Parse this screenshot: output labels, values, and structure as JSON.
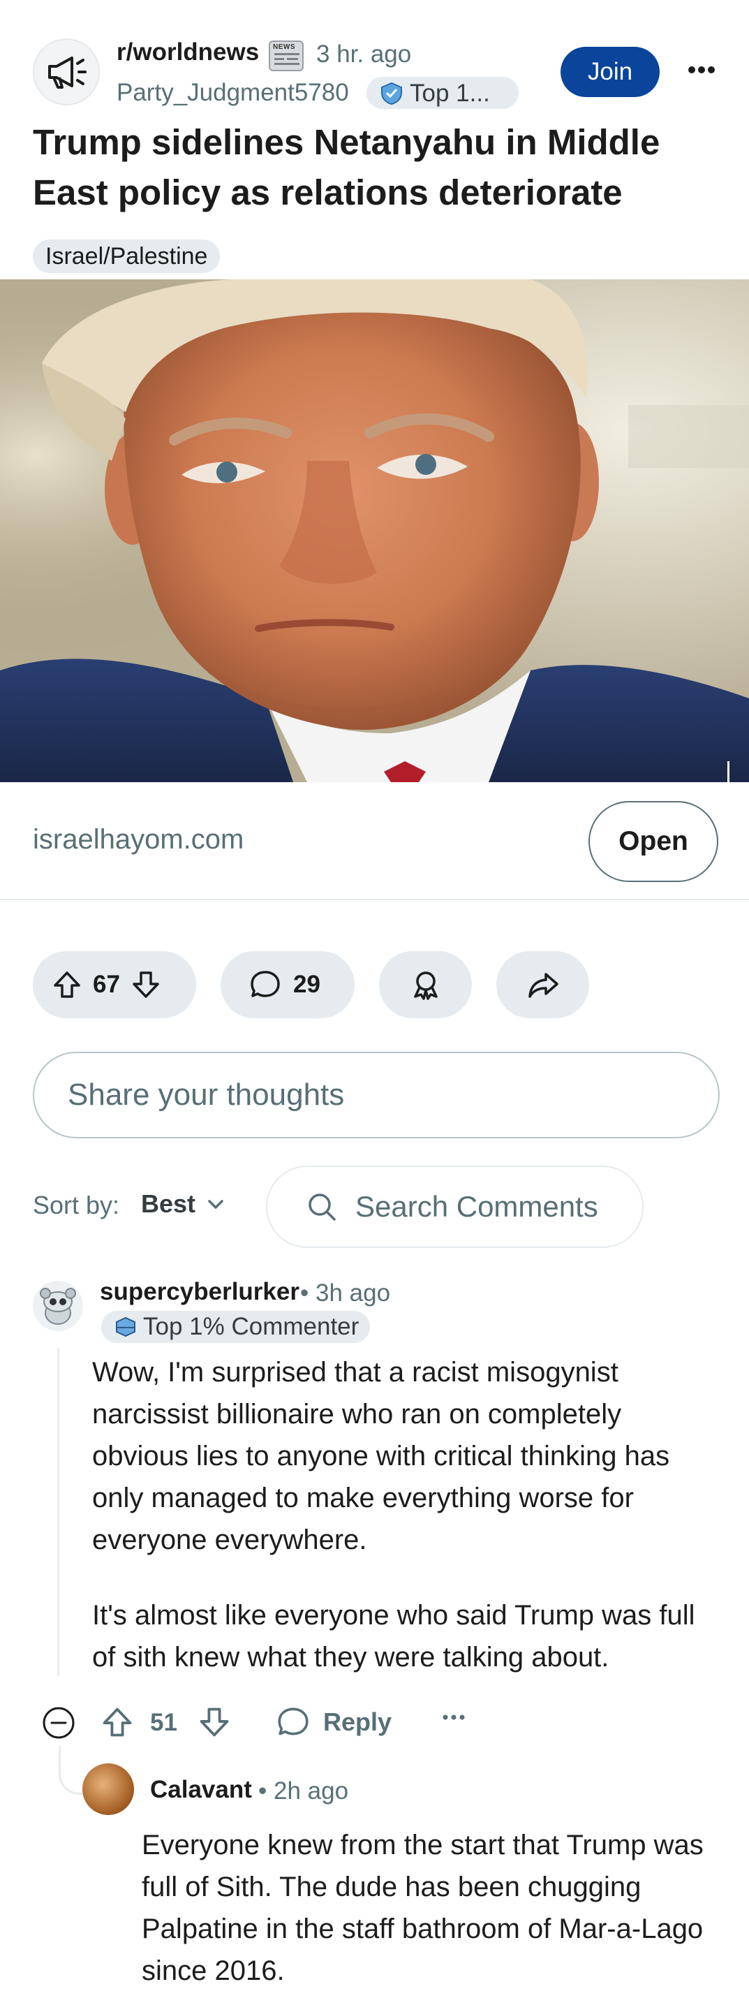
{
  "post": {
    "subreddit": "r/worldnews",
    "news_flair_text": "NEWS",
    "time": "3 hr. ago",
    "author": "Party_Judgment5780",
    "author_flair": "Top 1...",
    "join_label": "Join",
    "title": "Trump sidelines Netanyahu in Middle East policy as relations deteriorate",
    "flair": "Israel/Palestine",
    "link_domain": "israelhayom.com",
    "open_label": "Open",
    "upvotes": "67",
    "comments": "29"
  },
  "composer": {
    "placeholder": "Share your thoughts"
  },
  "sort": {
    "label": "Sort by:",
    "value": "Best",
    "search_label": "Search Comments"
  },
  "comments": [
    {
      "user": "supercyberlurker",
      "time": "3h ago",
      "flair": "Top 1% Commenter",
      "body_p1": "Wow, I'm surprised that a racist misogynist narcissist billionaire who ran on completely obvious lies to anyone with critical thinking has only managed to make everything worse for everyone everywhere.",
      "body_p2": "It's almost like everyone who said Trump was full of sith knew what they were talking about.",
      "score": "51",
      "reply_label": "Reply"
    },
    {
      "user": "Calavant",
      "time": "2h ago",
      "body": "Everyone knew from the start that Trump was full of Sith. The dude has been chugging Palpatine in the staff bathroom of Mar-a-Lago since 2016."
    }
  ],
  "colors": {
    "accent": "#0a449b",
    "meta": "#576f76",
    "pill": "#e5ebee"
  },
  "icons": [
    "megaphone-icon",
    "news-icon",
    "shield-badge-icon",
    "more-icon",
    "upvote-icon",
    "downvote-icon",
    "comment-icon",
    "award-icon",
    "share-icon",
    "search-icon",
    "chevron-down-icon",
    "collapse-icon",
    "reply-icon"
  ]
}
